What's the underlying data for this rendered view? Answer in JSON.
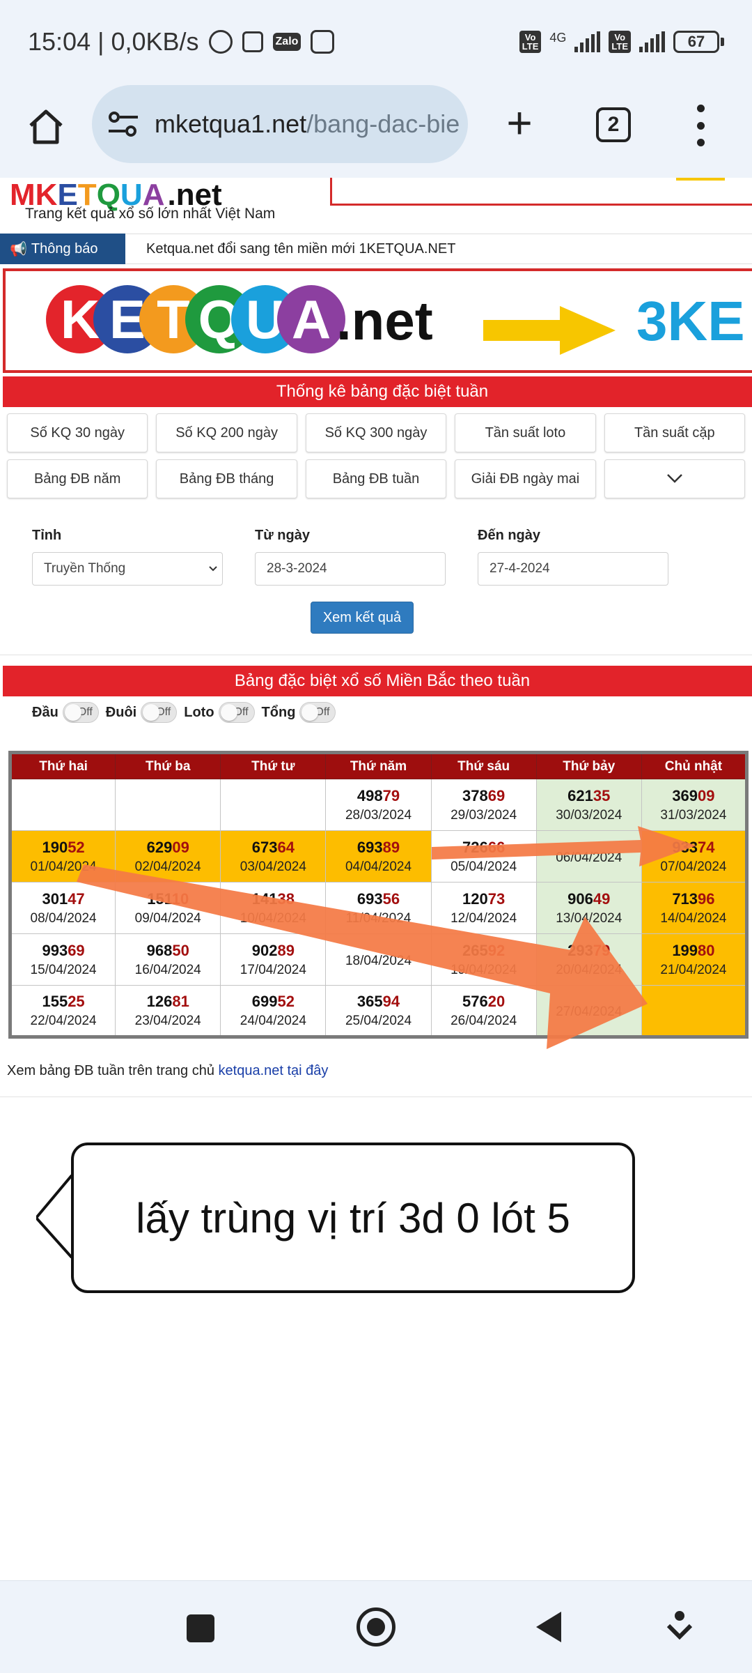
{
  "status_bar": {
    "time_speed": "15:04 | 0,0KB/s",
    "zalo": "Zalo",
    "volte1": "Vo\nLTE",
    "net_type": "4G",
    "volte2": "Vo\nLTE",
    "battery": "67"
  },
  "browser": {
    "url_domain": "mketqua1.net",
    "url_path": "/bang-dac-bie",
    "tabs_count": "2"
  },
  "site": {
    "logo_net": ".net",
    "tagline": "Trang kết quả xổ số lớn nhất Việt Nam",
    "notice_label": "Thông báo",
    "notice_text": "Ketqua.net đổi sang tên miền mới 1KETQUA.NET",
    "banner_letters": [
      "K",
      "E",
      "T",
      "Q",
      "U",
      "A"
    ],
    "banner_net": ".net",
    "banner_three": "3KE"
  },
  "stats_header": "Thống kê bảng đặc biệt tuần",
  "nav_buttons": [
    "Số KQ 30 ngày",
    "Số KQ 200 ngày",
    "Số KQ 300 ngày",
    "Tần suất loto",
    "Tần suất cặp",
    "Bảng ĐB năm",
    "Bảng ĐB tháng",
    "Bảng ĐB tuần",
    "Giải ĐB ngày mai"
  ],
  "form": {
    "tinh_label": "Tỉnh",
    "tinh_value": "Truyền Thống",
    "tu_ngay_label": "Từ ngày",
    "tu_ngay_value": "28-3-2024",
    "den_ngay_label": "Đến ngày",
    "den_ngay_value": "27-4-2024",
    "submit": "Xem kết quả"
  },
  "table_header": "Bảng đặc biệt xổ số Miền Bắc theo tuần",
  "toggles": {
    "dau": "Đầu",
    "duoi": "Đuôi",
    "loto": "Loto",
    "tong": "Tổng",
    "state": "Off"
  },
  "weekdays": [
    "Thứ hai",
    "Thứ ba",
    "Thứ tư",
    "Thứ năm",
    "Thứ sáu",
    "Thứ bảy",
    "Chủ nhật"
  ],
  "rows": [
    [
      {
        "a": "",
        "b": "",
        "date": ""
      },
      {
        "a": "",
        "b": "",
        "date": ""
      },
      {
        "a": "",
        "b": "",
        "date": ""
      },
      {
        "a": "498",
        "b": "79",
        "date": "28/03/2024"
      },
      {
        "a": "378",
        "b": "69",
        "date": "29/03/2024"
      },
      {
        "a": "621",
        "b": "35",
        "date": "30/03/2024"
      },
      {
        "a": "369",
        "b": "09",
        "date": "31/03/2024"
      }
    ],
    [
      {
        "a": "190",
        "b": "52",
        "date": "01/04/2024"
      },
      {
        "a": "629",
        "b": "09",
        "date": "02/04/2024"
      },
      {
        "a": "673",
        "b": "64",
        "date": "03/04/2024"
      },
      {
        "a": "693",
        "b": "89",
        "date": "04/04/2024"
      },
      {
        "a": "726",
        "b": "66",
        "date": "05/04/2024"
      },
      {
        "a": "",
        "b": "",
        "date": "06/04/2024"
      },
      {
        "a": "933",
        "b": "74",
        "date": "07/04/2024"
      }
    ],
    [
      {
        "a": "301",
        "b": "47",
        "date": "08/04/2024"
      },
      {
        "a": "151",
        "b": "10",
        "date": "09/04/2024"
      },
      {
        "a": "141",
        "b": "38",
        "date": "10/04/2024"
      },
      {
        "a": "693",
        "b": "56",
        "date": "11/04/2024"
      },
      {
        "a": "120",
        "b": "73",
        "date": "12/04/2024"
      },
      {
        "a": "906",
        "b": "49",
        "date": "13/04/2024"
      },
      {
        "a": "713",
        "b": "96",
        "date": "14/04/2024"
      }
    ],
    [
      {
        "a": "993",
        "b": "69",
        "date": "15/04/2024"
      },
      {
        "a": "968",
        "b": "50",
        "date": "16/04/2024"
      },
      {
        "a": "902",
        "b": "89",
        "date": "17/04/2024"
      },
      {
        "a": "",
        "b": "",
        "date": "18/04/2024"
      },
      {
        "a": "265",
        "b": "92",
        "date": "19/04/2024"
      },
      {
        "a": "293",
        "b": "79",
        "date": "20/04/2024"
      },
      {
        "a": "199",
        "b": "80",
        "date": "21/04/2024"
      }
    ],
    [
      {
        "a": "155",
        "b": "25",
        "date": "22/04/2024"
      },
      {
        "a": "126",
        "b": "81",
        "date": "23/04/2024"
      },
      {
        "a": "699",
        "b": "52",
        "date": "24/04/2024"
      },
      {
        "a": "365",
        "b": "94",
        "date": "25/04/2024"
      },
      {
        "a": "576",
        "b": "20",
        "date": "26/04/2024"
      },
      {
        "a": "",
        "b": "",
        "date": "27/04/2024"
      },
      {
        "a": "",
        "b": "",
        "date": ""
      }
    ]
  ],
  "footer": {
    "text": "Xem bảng ĐB tuần trên trang chủ ",
    "link": "ketqua.net tại đây"
  },
  "annotation": "lấy trùng vị trí 3d 0 lót 5"
}
